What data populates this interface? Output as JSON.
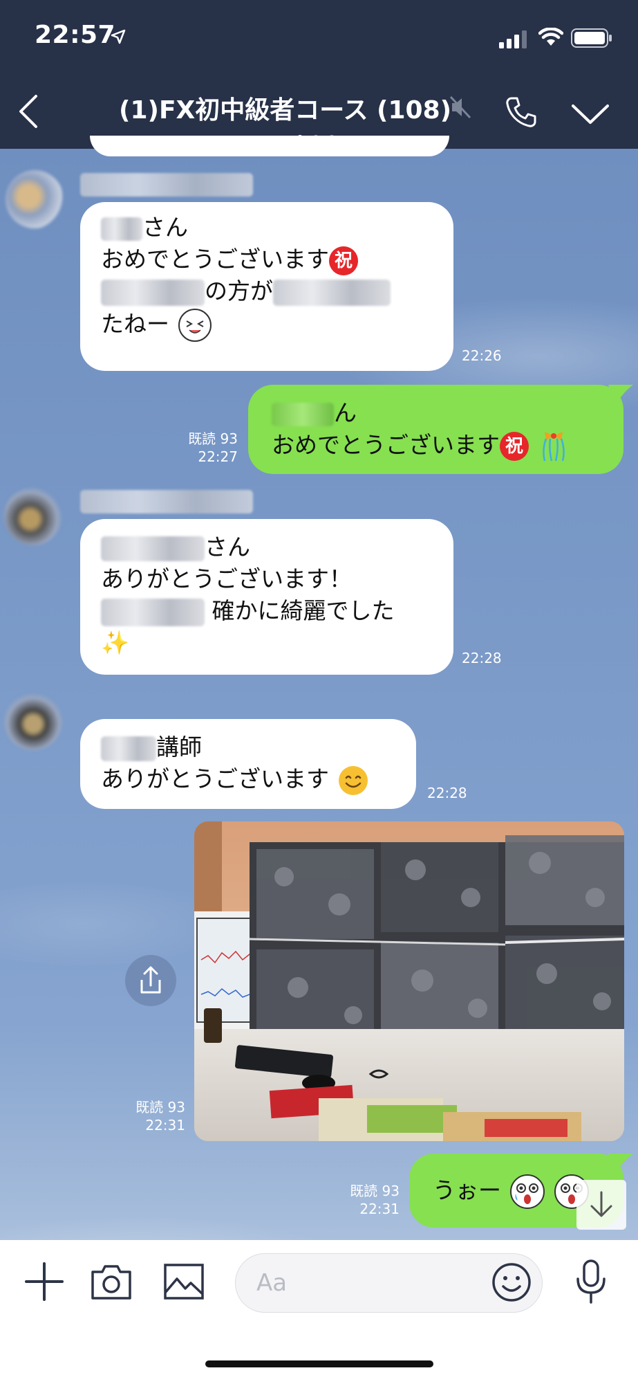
{
  "status_bar": {
    "time": "22:57"
  },
  "header": {
    "title": "(1)FX初中級者コース (108)"
  },
  "messages": [
    {
      "lines": [
        "さん",
        "おめでとうございます",
        "の方が",
        "たねー"
      ],
      "time": "22:26"
    },
    {
      "lines": [
        "ん",
        "おめでとうございます"
      ],
      "read": "既読 93",
      "time": "22:27"
    },
    {
      "lines": [
        "さん",
        "ありがとうございます！",
        "確かに綺麗でした"
      ],
      "time": "22:28"
    },
    {
      "lines": [
        "講師",
        "ありがとうございます"
      ],
      "time": "22:28"
    },
    {
      "read": "既読 93",
      "time": "22:31"
    },
    {
      "lines": [
        "うぉー"
      ],
      "read": "既読 93",
      "time": "22:31"
    }
  ],
  "emoji_label": "祝",
  "input": {
    "placeholder": "Aa"
  },
  "colors": {
    "header_bg": "#273148",
    "outgoing_bubble": "#86e050",
    "incoming_bubble": "#ffffff"
  }
}
